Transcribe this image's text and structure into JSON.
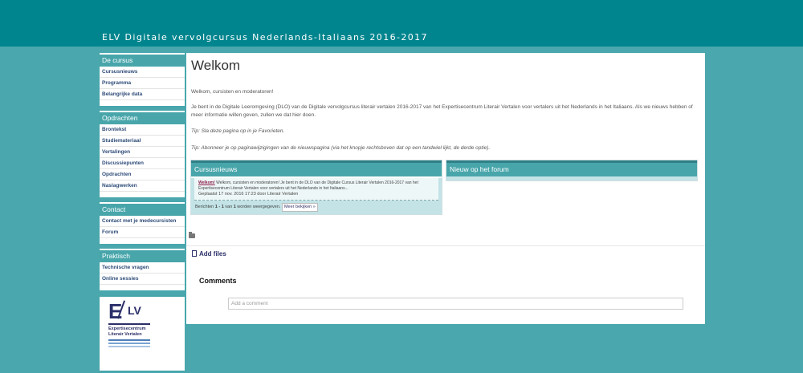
{
  "site": {
    "title": "ELV Digitale vervolgcursus Nederlands-Italiaans 2016-2017"
  },
  "sidebar": {
    "blocks": [
      {
        "title": "De cursus",
        "items": [
          "Cursusnieuws",
          "Programma",
          "Belangrijke data"
        ]
      },
      {
        "title": "Opdrachten",
        "items": [
          "Brontekst",
          "Studiemateriaal",
          "Vertalingen",
          "Discussiepunten",
          "Opdrachten",
          "Naslagwerken"
        ]
      },
      {
        "title": "Contact",
        "items": [
          "Contact met je medecursisten",
          "Forum"
        ]
      },
      {
        "title": "Praktisch",
        "items": [
          "Technische vragen",
          "Online sessies"
        ]
      }
    ],
    "logo": {
      "mark_e": "E",
      "mark_lv": "LV",
      "line1": "Expertisecentrum",
      "line2": "Literair Vertalen"
    }
  },
  "main": {
    "title": "Welkom",
    "paragraphs": [
      "Welkom, cursisten en moderatoren!",
      "Je bent in de Digitale Leeromgeving (DLO) van de Digitale vervolgcursus literair vertalen 2016-2017 van het Expertisecentrum Literair Vertalen voor vertalers uit het Nederlands in het Italiaans. Als we nieuws hebben of meer informatie willen geven, zullen we dat hier doen.",
      "Tip: Sla deze pagina op in je Favorieten.",
      "Tip: Abonneer je op paginawijzigingen van de nieuwspagina (via het knopje rechtsboven dat op een tandwiel lijkt, de derde optie)."
    ],
    "news_panel": {
      "title": "Cursusnieuws",
      "entry_link": "Welkom!",
      "entry_text": "Welkom, cursisten en moderatoren! Je bent in de DLO van de Digitale Cursus Literair Vertalen 2016-2017 van het Expertisecentrum Literair Vertalen voor vertalers uit het Nederlands in het Italiaans...",
      "entry_meta": "Geplaatst 17 nov. 2016 17:23 door Literair Vertalen",
      "footer_prefix": "Berichten ",
      "footer_range": "1 - 1",
      "footer_mid": " van ",
      "footer_count": "1",
      "footer_suffix": " worden weergegeven. ",
      "more_label": "Meer bekijken »"
    },
    "forum_panel": {
      "title": "Nieuw op het forum"
    },
    "add_files": "Add files",
    "comments_title": "Comments",
    "comment_placeholder": "Add a comment"
  }
}
